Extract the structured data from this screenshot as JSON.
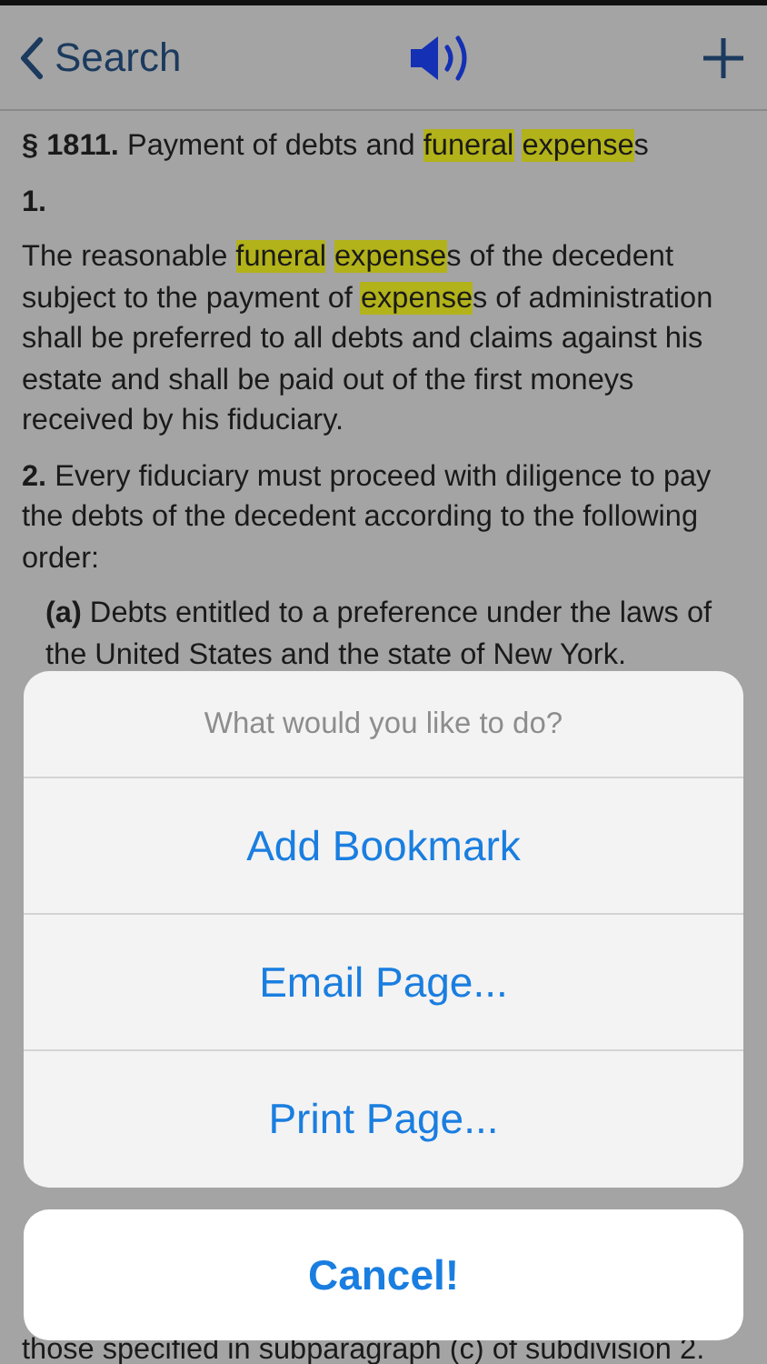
{
  "nav": {
    "back_label": "Search"
  },
  "heading": {
    "number": "§ 1811.",
    "segments": [
      {
        "text": " Payment of debts and ",
        "highlighted": false
      },
      {
        "text": "funeral",
        "highlighted": true
      },
      {
        "text": "expense",
        "highlighted": true,
        "space_before": true
      },
      {
        "text": "s",
        "highlighted": false
      }
    ]
  },
  "blocks": [
    {
      "kind": "para",
      "number": "1."
    },
    {
      "kind": "para",
      "segments": [
        {
          "text": "The reasonable ",
          "highlighted": false
        },
        {
          "text": "funeral",
          "highlighted": true
        },
        {
          "text": "expense",
          "highlighted": true,
          "space_before": true
        },
        {
          "text": "s of the decedent subject to the payment of ",
          "highlighted": false
        },
        {
          "text": "expense",
          "highlighted": true
        },
        {
          "text": "s of administration shall be preferred to all debts and claims against his estate and shall be paid out of the first moneys received by his fiduciary.",
          "highlighted": false
        }
      ]
    },
    {
      "kind": "para",
      "number": "2.",
      "segments": [
        {
          "text": " Every fiduciary must proceed with diligence to pay the debts of the decedent according to the following order:",
          "highlighted": false
        }
      ]
    },
    {
      "kind": "subpara",
      "number": "(a)",
      "segments": [
        {
          "text": " Debts entitled to a preference under the laws of the United States and the state of New York.",
          "highlighted": false
        }
      ]
    }
  ],
  "tail": "those specified in subparagraph (c) of subdivision 2.",
  "sheet": {
    "title": "What would you like to do?",
    "actions": [
      "Add Bookmark",
      "Email Page...",
      "Print Page..."
    ],
    "cancel": "Cancel!"
  }
}
